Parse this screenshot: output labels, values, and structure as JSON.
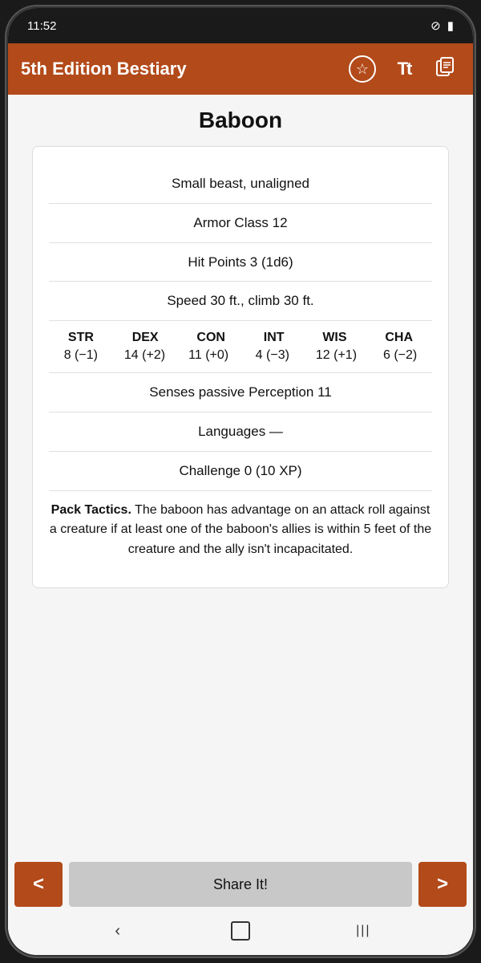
{
  "status_bar": {
    "time": "11:52",
    "icons": [
      "⊘",
      "🔋"
    ]
  },
  "app_bar": {
    "title": "5th Edition Bestiary",
    "icons": {
      "favorite": "☆",
      "text_size": "Tt",
      "copy": "📋"
    }
  },
  "creature": {
    "name": "Baboon",
    "type": "Small beast, unaligned",
    "armor_class": "Armor Class 12",
    "hit_points": "Hit Points 3 (1d6)",
    "speed": "Speed 30 ft., climb 30 ft.",
    "ability_scores": {
      "headers": [
        "STR",
        "DEX",
        "CON",
        "INT",
        "WIS",
        "CHA"
      ],
      "values": [
        "8 (−1)",
        "14 (+2)",
        "11 (+0)",
        "4 (−3)",
        "12 (+1)",
        "6 (−2)"
      ]
    },
    "senses": "Senses passive Perception 11",
    "languages": "Languages —",
    "challenge": "Challenge 0 (10 XP)",
    "special_abilities": [
      {
        "name": "Pack Tactics.",
        "description": "The baboon has advantage on an attack roll against a creature if at least one of the baboon's allies is within 5 feet of the creature and the ally isn't incapacitated."
      }
    ]
  },
  "bottom": {
    "prev_label": "<",
    "share_label": "Share It!",
    "next_label": ">"
  },
  "system_nav": {
    "back": "‹",
    "home": "○",
    "recents": "|||"
  }
}
